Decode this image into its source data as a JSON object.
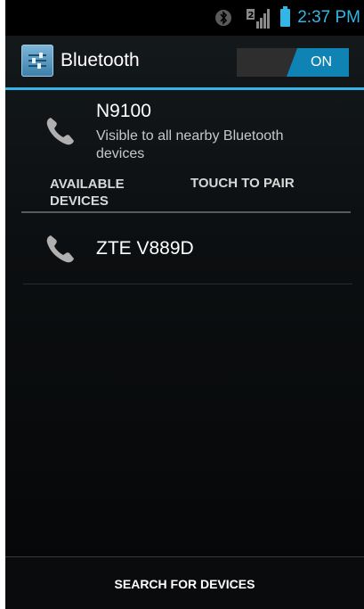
{
  "status_bar": {
    "time": "2:37 PM",
    "icons": [
      "bluetooth-icon",
      "signal-icon",
      "battery-icon"
    ],
    "accent": "#33b5e5"
  },
  "action_bar": {
    "title": "Bluetooth",
    "toggle_state": "ON"
  },
  "this_device": {
    "name": "N9100",
    "subtitle": "Visible to all nearby Bluetooth devices"
  },
  "section": {
    "title": "AVAILABLE DEVICES",
    "hint": "TOUCH TO PAIR"
  },
  "available_devices": [
    {
      "name": "ZTE V889D",
      "icon": "phone-icon"
    }
  ],
  "bottom_bar": {
    "label": "SEARCH FOR DEVICES"
  }
}
